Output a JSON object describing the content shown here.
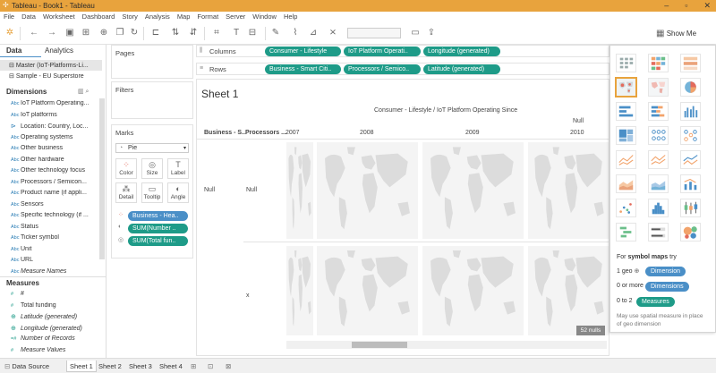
{
  "window": {
    "title": "Tableau - Book1 - Tableau"
  },
  "menu": [
    "File",
    "Data",
    "Worksheet",
    "Dashboard",
    "Story",
    "Analysis",
    "Map",
    "Format",
    "Server",
    "Window",
    "Help"
  ],
  "toolbar": {
    "show_me": "Show Me"
  },
  "data_pane": {
    "tabs": [
      "Data",
      "Analytics"
    ],
    "sources": [
      "Master (IoT-Platforms-Li...",
      "Sample - EU Superstore"
    ],
    "dimensions_label": "Dimensions",
    "dimensions": [
      {
        "type": "Abc",
        "name": "IoT Platform Operating..."
      },
      {
        "type": "Abc",
        "name": "IoT platforms"
      },
      {
        "type": "geo",
        "name": "Location: Country, Loc..."
      },
      {
        "type": "Abc",
        "name": "Operating systems"
      },
      {
        "type": "Abc",
        "name": "Other business"
      },
      {
        "type": "Abc",
        "name": "Other hardware"
      },
      {
        "type": "Abc",
        "name": "Other technology focus"
      },
      {
        "type": "Abc",
        "name": "Processors / Semicon..."
      },
      {
        "type": "Abc",
        "name": "Product name (if appli..."
      },
      {
        "type": "Abc",
        "name": "Sensors"
      },
      {
        "type": "Abc",
        "name": "Specific technology (if ..."
      },
      {
        "type": "Abc",
        "name": "Status"
      },
      {
        "type": "Abc",
        "name": "Ticker symbol"
      },
      {
        "type": "Abc",
        "name": "Unit"
      },
      {
        "type": "Abc",
        "name": "URL"
      },
      {
        "type": "Abc",
        "name": "Measure Names"
      }
    ],
    "measures_label": "Measures",
    "measures": [
      {
        "type": "#",
        "name": "#"
      },
      {
        "type": "#",
        "name": "Total funding"
      },
      {
        "type": "geo",
        "name": "Latitude (generated)"
      },
      {
        "type": "geo",
        "name": "Longitude (generated)"
      },
      {
        "type": "=#",
        "name": "Number of Records"
      },
      {
        "type": "#",
        "name": "Measure Values"
      }
    ]
  },
  "shelves": {
    "pages": "Pages",
    "filters": "Filters",
    "marks": "Marks",
    "mark_type": "Pie",
    "mark_buttons": [
      "Color",
      "Size",
      "Label",
      "Detail",
      "Tooltip",
      "Angle"
    ],
    "mark_pills": [
      "Business - Hea..",
      "SUM(Number ..",
      "SUM(Total fun.."
    ],
    "columns_label": "Columns",
    "columns": [
      "Consumer - Lifestyle",
      "IoT Platform Operati..",
      "Longitude (generated)"
    ],
    "rows_label": "Rows",
    "rows": [
      "Business - Smart Citi..",
      "Processors / Semico..",
      "Latitude (generated)"
    ]
  },
  "view": {
    "sheet_title": "Sheet 1",
    "header_top": "Consumer - Lifestyle / IoT Platform Operating Since",
    "header_null_top": "Null",
    "row_headers": [
      "Business - S...",
      "Processors ..."
    ],
    "years": [
      "2007",
      "2008",
      "2009",
      "2010"
    ],
    "row_null_1": "Null",
    "row_null_2": "Null",
    "row_x": "x",
    "nulls_badge": "52 nulls"
  },
  "show_me": {
    "for_text_prefix": "For ",
    "for_text_bold": "symbol maps",
    "for_text_suffix": " try",
    "req1_prefix": "1 geo",
    "req1_pill": "Dimension",
    "req2_prefix": "0 or more",
    "req2_pill": "Dimensions",
    "req3_prefix": "0 to 2",
    "req3_pill": "Measures",
    "note": "May use spatial measure in place of geo dimension"
  },
  "bottom_tabs": {
    "data_source": "Data Source",
    "sheets": [
      "Sheet 1",
      "Sheet 2",
      "Sheet 3",
      "Sheet 4"
    ]
  },
  "colors": {
    "accent": "#e8a33d",
    "dimension": "#4a8fc7",
    "measure": "#1e9b88"
  }
}
